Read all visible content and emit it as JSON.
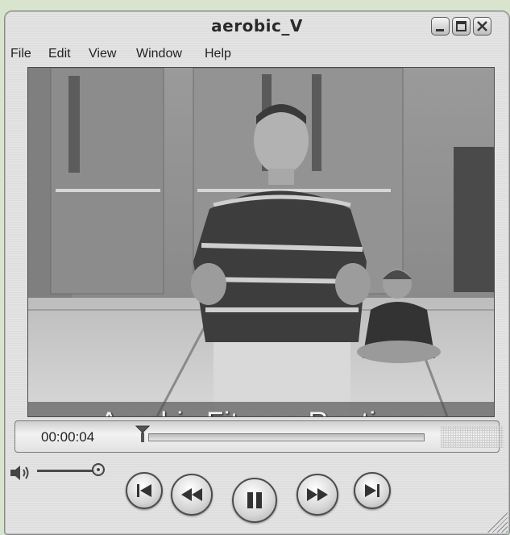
{
  "window": {
    "title": "aerobic_V"
  },
  "menu": [
    "File",
    "Edit",
    "View",
    "Window",
    "Help"
  ],
  "video": {
    "caption": "Aerobic Fitness Routines"
  },
  "timeline": {
    "time": "00:00:04",
    "progress": 0.02
  },
  "volume": {
    "level": 0.9
  },
  "controls": [
    "previous",
    "rewind",
    "pause",
    "fast-forward",
    "next"
  ]
}
